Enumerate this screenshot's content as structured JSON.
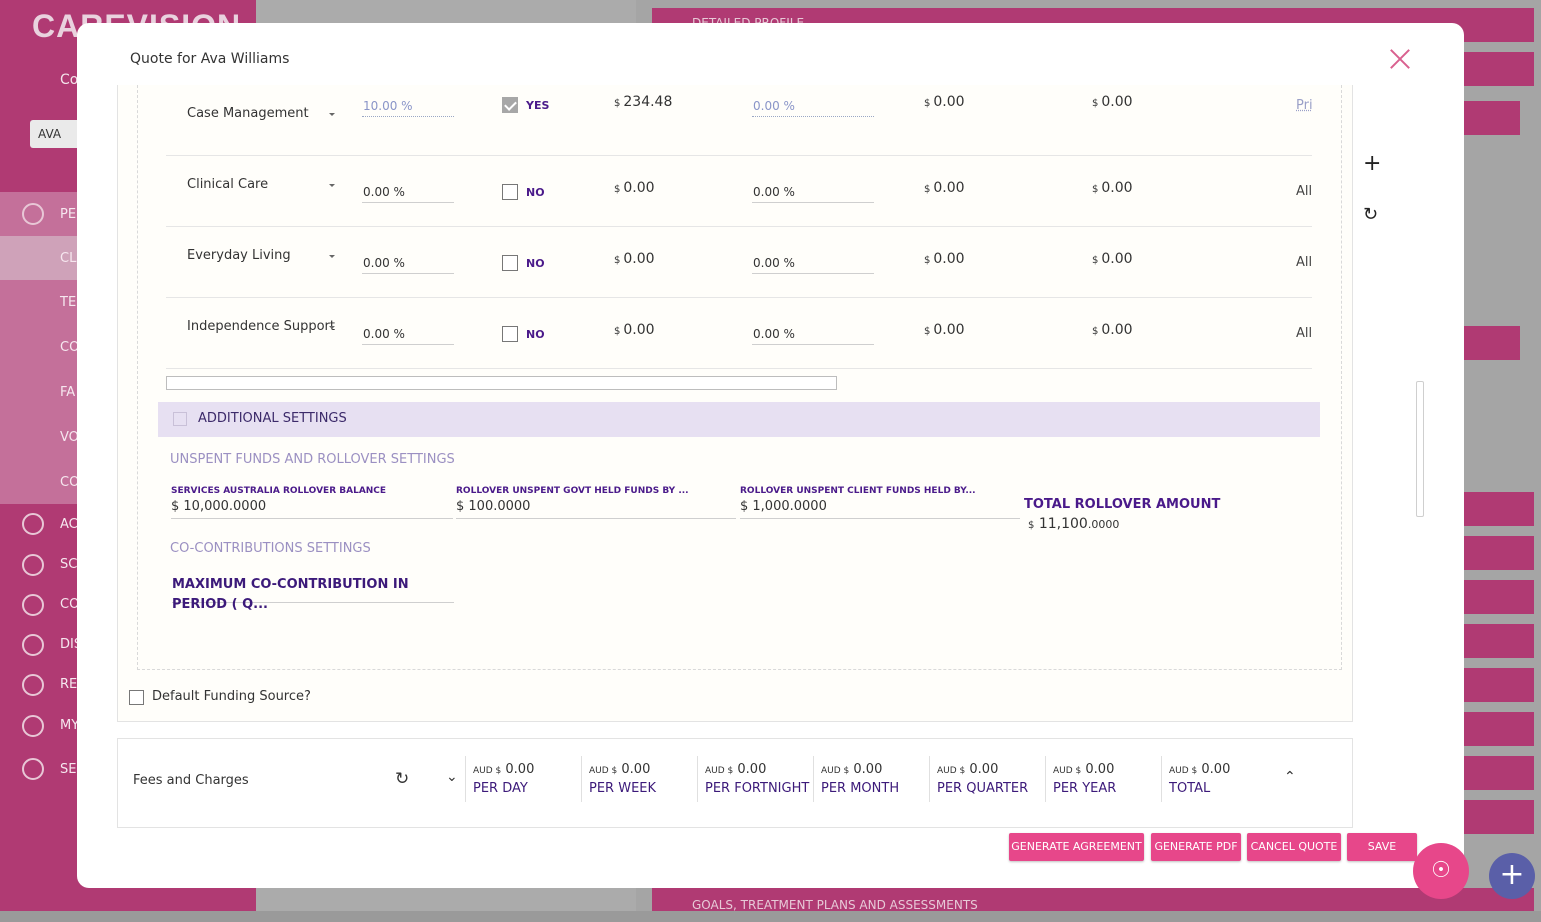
{
  "background": {
    "logo": "CAREVISION",
    "co_label": "Co",
    "client_chip": "AVA",
    "nav_items": [
      "PE",
      "CL",
      "TE",
      "CO",
      "FA",
      "VO",
      "CO",
      "AC",
      "SC",
      "CO",
      "DIS",
      "RE",
      "MY",
      "SE"
    ],
    "top_bar_label": "DETAILED PROFILE",
    "bottom_bar_label": "GOALS, TREATMENT PLANS AND ASSESSMENTS"
  },
  "modal": {
    "title": "Quote for Ava Williams"
  },
  "categories": [
    {
      "name": "Case Management",
      "pct": "10.00 %",
      "checked": true,
      "yn": "YES",
      "amount": "234.48",
      "pct2": "0.00 %",
      "amount2": "0.00",
      "amount3": "0.00",
      "applies": "Pri"
    },
    {
      "name": "Clinical Care",
      "pct": "0.00 %",
      "checked": false,
      "yn": "NO",
      "amount": "0.00",
      "pct2": "0.00 %",
      "amount2": "0.00",
      "amount3": "0.00",
      "applies": "All"
    },
    {
      "name": "Everyday Living",
      "pct": "0.00 %",
      "checked": false,
      "yn": "NO",
      "amount": "0.00",
      "pct2": "0.00 %",
      "amount2": "0.00",
      "amount3": "0.00",
      "applies": "All"
    },
    {
      "name": "Independence Support",
      "pct": "0.00 %",
      "checked": false,
      "yn": "NO",
      "amount": "0.00",
      "pct2": "0.00 %",
      "amount2": "0.00",
      "amount3": "0.00",
      "applies": "All"
    }
  ],
  "currency_symbol": "$",
  "additional_settings": {
    "label": "ADDITIONAL SETTINGS",
    "unspent_title": "UNSPENT FUNDS AND ROLLOVER SETTINGS",
    "fields": [
      {
        "label": "SERVICES AUSTRALIA ROLLOVER BALANCE",
        "value": "$ 10,000.0000"
      },
      {
        "label": "ROLLOVER UNSPENT GOVT HELD FUNDS BY ...",
        "value": "$ 100.0000"
      },
      {
        "label": "ROLLOVER UNSPENT CLIENT FUNDS HELD BY...",
        "value": "$ 1,000.0000"
      }
    ],
    "total_label": "TOTAL ROLLOVER AMOUNT",
    "total_main": "11,100",
    "total_decimals": ".0000",
    "cocontrib_title": "CO-CONTRIBUTIONS SETTINGS",
    "max_cocontrib": "MAXIMUM CO-CONTRIBUTION IN PERIOD ( Q..."
  },
  "default_funding": {
    "label": "Default Funding Source?",
    "checked": false
  },
  "fees": {
    "title": "Fees and Charges",
    "currency_prefix": "AUD $",
    "columns": [
      {
        "amount": "0.00",
        "label": "PER DAY"
      },
      {
        "amount": "0.00",
        "label": "PER WEEK"
      },
      {
        "amount": "0.00",
        "label": "PER FORTNIGHT"
      },
      {
        "amount": "0.00",
        "label": "PER MONTH"
      },
      {
        "amount": "0.00",
        "label": "PER QUARTER"
      },
      {
        "amount": "0.00",
        "label": "PER YEAR"
      },
      {
        "amount": "0.00",
        "label": "TOTAL"
      }
    ]
  },
  "buttons": {
    "generate_agreement": "GENERATE AGREEMENT",
    "generate_pdf": "GENERATE PDF",
    "cancel_quote": "CANCEL QUOTE",
    "save": "SAVE"
  },
  "icons": {
    "close": "close-icon",
    "add": "plus-icon",
    "refresh": "refresh-icon",
    "bulb": "lightbulb-icon",
    "fab": "plus-icon"
  },
  "colors": {
    "brand_pink": "#e7478a",
    "purple_text": "#4a1a8a",
    "settings_band": "#e7e0f2"
  }
}
